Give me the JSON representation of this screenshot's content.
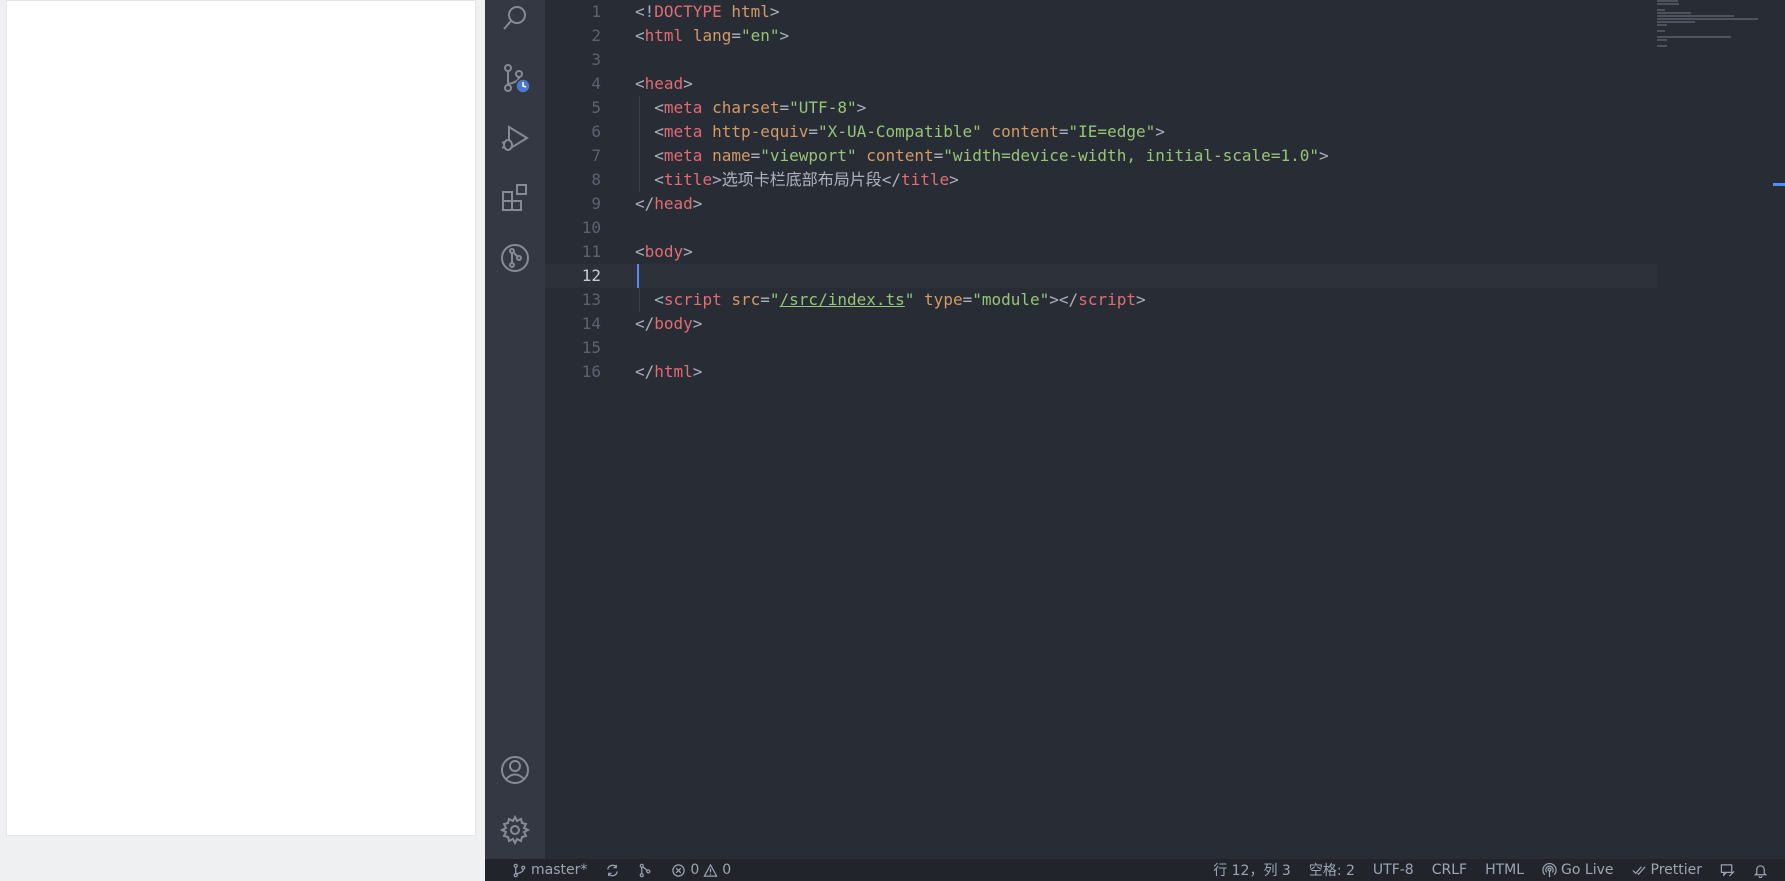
{
  "preview": {},
  "activity_bar": {
    "top": [
      "search-icon",
      "source-control-icon",
      "run-debug-icon",
      "extensions-icon",
      "git-graph-icon"
    ],
    "bottom": [
      "account-icon",
      "settings-gear-icon"
    ]
  },
  "editor": {
    "current_line": 12,
    "lines": [
      {
        "n": "1",
        "tokens": [
          [
            "punc",
            "<!"
          ],
          [
            "tag",
            "DOCTYPE"
          ],
          [
            "punc",
            " "
          ],
          [
            "attr",
            "html"
          ],
          [
            "punc",
            ">"
          ]
        ]
      },
      {
        "n": "2",
        "tokens": [
          [
            "punc",
            "<"
          ],
          [
            "tag",
            "html"
          ],
          [
            "punc",
            " "
          ],
          [
            "attr",
            "lang"
          ],
          [
            "punc",
            "="
          ],
          [
            "str",
            "\"en\""
          ],
          [
            "punc",
            ">"
          ]
        ]
      },
      {
        "n": "3",
        "tokens": []
      },
      {
        "n": "4",
        "tokens": [
          [
            "punc",
            "<"
          ],
          [
            "tag",
            "head"
          ],
          [
            "punc",
            ">"
          ]
        ]
      },
      {
        "n": "5",
        "tokens": [
          [
            "punc",
            "  <"
          ],
          [
            "tag",
            "meta"
          ],
          [
            "punc",
            " "
          ],
          [
            "attr",
            "charset"
          ],
          [
            "punc",
            "="
          ],
          [
            "str",
            "\"UTF-8\""
          ],
          [
            "punc",
            ">"
          ]
        ]
      },
      {
        "n": "6",
        "tokens": [
          [
            "punc",
            "  <"
          ],
          [
            "tag",
            "meta"
          ],
          [
            "punc",
            " "
          ],
          [
            "attr",
            "http-equiv"
          ],
          [
            "punc",
            "="
          ],
          [
            "str",
            "\"X-UA-Compatible\""
          ],
          [
            "punc",
            " "
          ],
          [
            "attr",
            "content"
          ],
          [
            "punc",
            "="
          ],
          [
            "str",
            "\"IE=edge\""
          ],
          [
            "punc",
            ">"
          ]
        ]
      },
      {
        "n": "7",
        "tokens": [
          [
            "punc",
            "  <"
          ],
          [
            "tag",
            "meta"
          ],
          [
            "punc",
            " "
          ],
          [
            "attr",
            "name"
          ],
          [
            "punc",
            "="
          ],
          [
            "str",
            "\"viewport\""
          ],
          [
            "punc",
            " "
          ],
          [
            "attr",
            "content"
          ],
          [
            "punc",
            "="
          ],
          [
            "str",
            "\"width=device-width, initial-scale=1.0\""
          ],
          [
            "punc",
            ">"
          ]
        ]
      },
      {
        "n": "8",
        "tokens": [
          [
            "punc",
            "  <"
          ],
          [
            "tag",
            "title"
          ],
          [
            "punc",
            ">"
          ],
          [
            "txt",
            "选项卡栏底部布局片段"
          ],
          [
            "punc",
            "</"
          ],
          [
            "tag",
            "title"
          ],
          [
            "punc",
            ">"
          ]
        ]
      },
      {
        "n": "9",
        "tokens": [
          [
            "punc",
            "</"
          ],
          [
            "tag",
            "head"
          ],
          [
            "punc",
            ">"
          ]
        ]
      },
      {
        "n": "10",
        "tokens": []
      },
      {
        "n": "11",
        "tokens": [
          [
            "punc",
            "<"
          ],
          [
            "tag",
            "body"
          ],
          [
            "punc",
            ">"
          ]
        ]
      },
      {
        "n": "12",
        "tokens": []
      },
      {
        "n": "13",
        "tokens": [
          [
            "punc",
            "  <"
          ],
          [
            "tag",
            "script"
          ],
          [
            "punc",
            " "
          ],
          [
            "attr",
            "src"
          ],
          [
            "punc",
            "="
          ],
          [
            "str",
            "\""
          ],
          [
            "strlink",
            "/src/index.ts"
          ],
          [
            "str",
            "\""
          ],
          [
            "punc",
            " "
          ],
          [
            "attr",
            "type"
          ],
          [
            "punc",
            "="
          ],
          [
            "str",
            "\"module\""
          ],
          [
            "punc",
            "></"
          ],
          [
            "tag",
            "script"
          ],
          [
            "punc",
            ">"
          ]
        ]
      },
      {
        "n": "14",
        "tokens": [
          [
            "punc",
            "</"
          ],
          [
            "tag",
            "body"
          ],
          [
            "punc",
            ">"
          ]
        ]
      },
      {
        "n": "15",
        "tokens": []
      },
      {
        "n": "16",
        "tokens": [
          [
            "punc",
            "</"
          ],
          [
            "tag",
            "html"
          ],
          [
            "punc",
            ">"
          ]
        ]
      }
    ]
  },
  "statusbar": {
    "branch": "master*",
    "errors": "0",
    "warnings": "0",
    "position": "行 12，列 3",
    "spaces": "空格: 2",
    "encoding": "UTF-8",
    "eol": "CRLF",
    "language": "HTML",
    "go_live": "Go Live",
    "prettier": "Prettier"
  },
  "colors": {
    "editor_bg": "#282c34",
    "activity_bg": "#333842",
    "statusbar_bg": "#21252b",
    "tag": "#e06c75",
    "attr": "#d19a66",
    "string": "#98c379"
  }
}
